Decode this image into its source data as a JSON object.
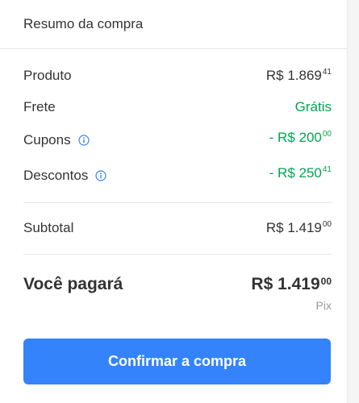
{
  "summary": {
    "title": "Resumo da compra"
  },
  "lines": {
    "produto": {
      "label": "Produto",
      "int": "R$ 1.869",
      "cents": "41"
    },
    "frete": {
      "label": "Frete",
      "value": "Grátis"
    },
    "cupons": {
      "label": "Cupons",
      "int": "- R$ 200",
      "cents": "00"
    },
    "descontos": {
      "label": "Descontos",
      "int": "- R$ 250",
      "cents": "41"
    },
    "subtotal": {
      "label": "Subtotal",
      "int": "R$ 1.419",
      "cents": "00"
    }
  },
  "total": {
    "label": "Você pagará",
    "int": "R$ 1.419",
    "cents": "00",
    "method": "Pix"
  },
  "actions": {
    "confirm_label": "Confirmar a compra"
  },
  "colors": {
    "accent": "#3483fa",
    "discount_green": "#00a650",
    "info_icon": "#3483fa"
  }
}
